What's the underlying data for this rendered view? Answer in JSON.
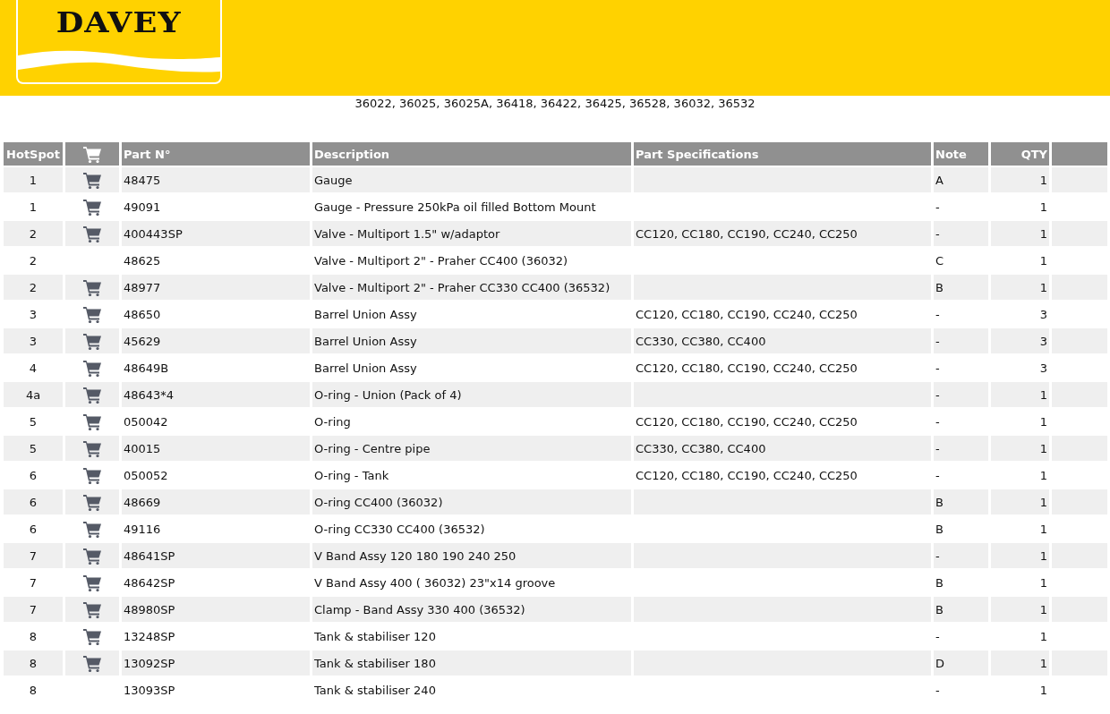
{
  "logo": {
    "text": "DAVEY"
  },
  "models": "36022, 36025, 36025A, 36418, 36422, 36425, 36528, 36032, 36532",
  "table": {
    "columns": [
      "HotSpot",
      "Part N°",
      "Description",
      "Part Specifications",
      "Note",
      "QTY"
    ],
    "rows": [
      {
        "hotspot": "1",
        "cart": true,
        "part": "48475",
        "description": "Gauge",
        "specs": "",
        "note": "A",
        "qty": "1"
      },
      {
        "hotspot": "1",
        "cart": true,
        "part": "49091",
        "description": "Gauge - Pressure 250kPa oil filled Bottom Mount",
        "specs": "",
        "note": "-",
        "qty": "1"
      },
      {
        "hotspot": "2",
        "cart": true,
        "part": "400443SP",
        "description": "Valve - Multiport 1.5\" w/adaptor",
        "specs": "CC120, CC180, CC190, CC240, CC250",
        "note": "-",
        "qty": "1"
      },
      {
        "hotspot": "2",
        "cart": false,
        "part": "48625",
        "description": "Valve - Multiport 2\" - Praher CC400 (36032)",
        "specs": "",
        "note": "C",
        "qty": "1"
      },
      {
        "hotspot": "2",
        "cart": true,
        "part": "48977",
        "description": "Valve - Multiport 2\" - Praher CC330 CC400 (36532)",
        "specs": "",
        "note": "B",
        "qty": "1"
      },
      {
        "hotspot": "3",
        "cart": true,
        "part": "48650",
        "description": "Barrel Union Assy",
        "specs": "CC120, CC180, CC190, CC240, CC250",
        "note": "-",
        "qty": "3"
      },
      {
        "hotspot": "3",
        "cart": true,
        "part": "45629",
        "description": "Barrel Union Assy",
        "specs": "CC330, CC380, CC400",
        "note": "-",
        "qty": "3"
      },
      {
        "hotspot": "4",
        "cart": true,
        "part": "48649B",
        "description": "Barrel Union Assy",
        "specs": "CC120, CC180, CC190, CC240, CC250",
        "note": "-",
        "qty": "3"
      },
      {
        "hotspot": "4a",
        "cart": true,
        "part": "48643*4",
        "description": "O-ring - Union (Pack of 4)",
        "specs": "",
        "note": "-",
        "qty": "1"
      },
      {
        "hotspot": "5",
        "cart": true,
        "part": "050042",
        "description": "O-ring",
        "specs": "CC120, CC180, CC190, CC240, CC250",
        "note": "-",
        "qty": "1"
      },
      {
        "hotspot": "5",
        "cart": true,
        "part": "40015",
        "description": "O-ring - Centre pipe",
        "specs": "CC330, CC380, CC400",
        "note": "-",
        "qty": "1"
      },
      {
        "hotspot": "6",
        "cart": true,
        "part": "050052",
        "description": "O-ring - Tank",
        "specs": "CC120, CC180, CC190, CC240, CC250",
        "note": "-",
        "qty": "1"
      },
      {
        "hotspot": "6",
        "cart": true,
        "part": "48669",
        "description": "O-ring CC400 (36032)",
        "specs": "",
        "note": "B",
        "qty": "1"
      },
      {
        "hotspot": "6",
        "cart": true,
        "part": "49116",
        "description": "O-ring CC330 CC400 (36532)",
        "specs": "",
        "note": "B",
        "qty": "1"
      },
      {
        "hotspot": "7",
        "cart": true,
        "part": "48641SP",
        "description": "V Band Assy 120 180 190 240 250",
        "specs": "",
        "note": "-",
        "qty": "1"
      },
      {
        "hotspot": "7",
        "cart": true,
        "part": "48642SP",
        "description": "V Band Assy 400 ( 36032) 23\"x14 groove",
        "specs": "",
        "note": "B",
        "qty": "1"
      },
      {
        "hotspot": "7",
        "cart": true,
        "part": "48980SP",
        "description": "Clamp - Band Assy 330 400 (36532)",
        "specs": "",
        "note": "B",
        "qty": "1"
      },
      {
        "hotspot": "8",
        "cart": true,
        "part": "13248SP",
        "description": "Tank & stabiliser 120",
        "specs": "",
        "note": "-",
        "qty": "1"
      },
      {
        "hotspot": "8",
        "cart": true,
        "part": "13092SP",
        "description": "Tank & stabiliser 180",
        "specs": "",
        "note": "D",
        "qty": "1"
      },
      {
        "hotspot": "8",
        "cart": false,
        "part": "13093SP",
        "description": "Tank & stabiliser 240",
        "specs": "",
        "note": "-",
        "qty": "1"
      }
    ]
  }
}
